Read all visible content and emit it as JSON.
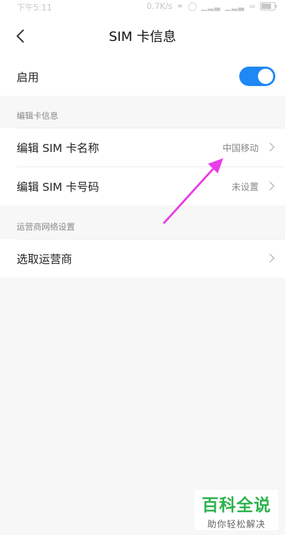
{
  "status_bar": {
    "time": "下午5:11",
    "network_speed": "0.7K/s"
  },
  "header": {
    "title": "SIM 卡信息"
  },
  "enable_row": {
    "label": "启用",
    "enabled": true
  },
  "edit_section": {
    "heading": "编辑卡信息",
    "items": [
      {
        "label": "编辑 SIM 卡名称",
        "value": "中国移动"
      },
      {
        "label": "编辑 SIM 卡号码",
        "value": "未设置"
      }
    ]
  },
  "carrier_section": {
    "heading": "运营商网络设置",
    "items": [
      {
        "label": "选取运营商"
      }
    ]
  },
  "watermark": {
    "title": "百科全说",
    "subtitle": "助你轻松解决"
  },
  "colors": {
    "accent": "#1e88f5",
    "annotation_arrow": "#e83ee8",
    "watermark_green": "#2bb24c"
  }
}
